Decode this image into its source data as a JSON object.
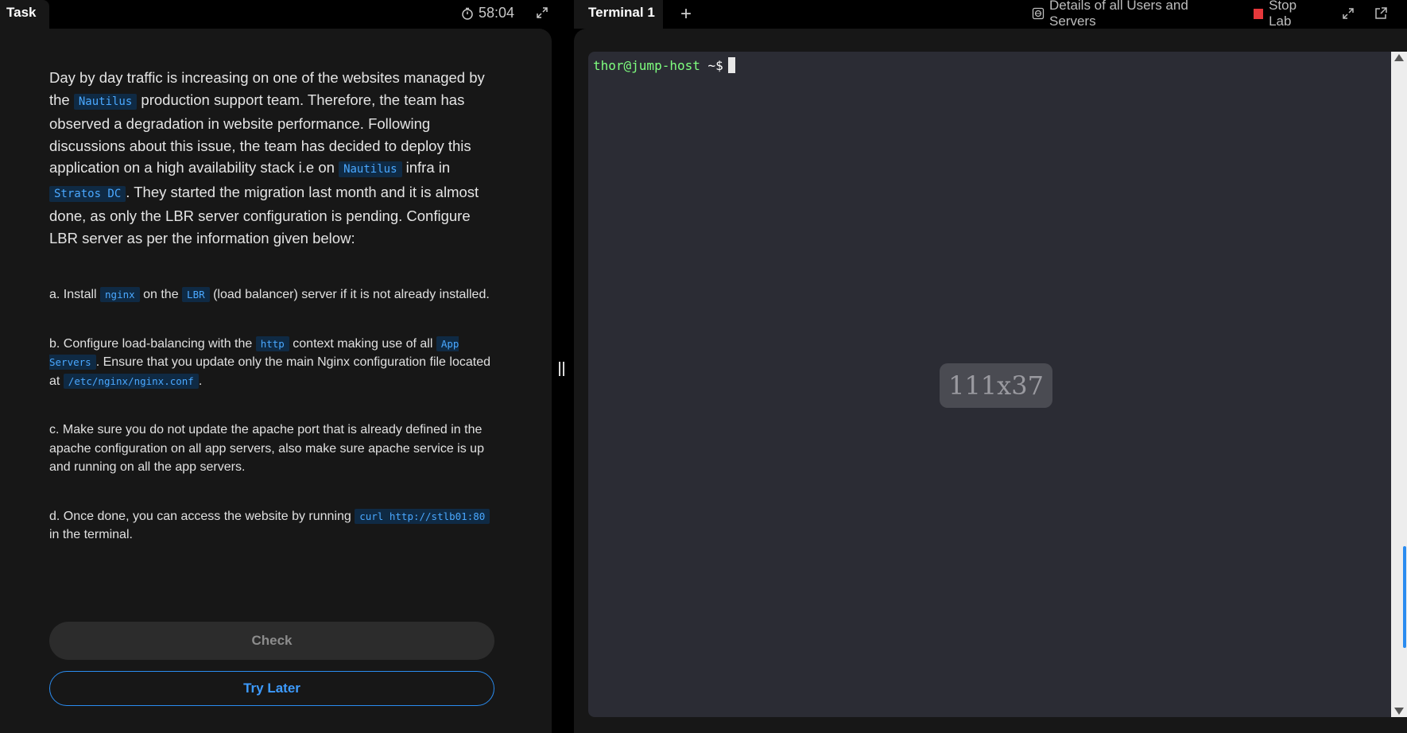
{
  "left": {
    "tab_label": "Task",
    "timer": "58:04"
  },
  "task": {
    "intro": [
      {
        "t": "Day by day traffic is increasing on one of the websites managed by the "
      },
      {
        "c": "Nautilus"
      },
      {
        "t": " production support team. Therefore, the team has observed a degradation in website performance. Following discussions about this issue, the team has decided to deploy this application on a high availability stack i.e on "
      },
      {
        "c": "Nautilus"
      },
      {
        "t": " infra in "
      },
      {
        "c": "Stratos DC"
      },
      {
        "t": ". They started the migration last month and it is almost done, as only the LBR server configuration is pending. Configure LBR server as per the information given below:"
      }
    ],
    "steps": [
      [
        {
          "t": "a. Install "
        },
        {
          "c": "nginx"
        },
        {
          "t": " on the "
        },
        {
          "c": "LBR"
        },
        {
          "t": " (load balancer) server if it is not already installed."
        }
      ],
      [
        {
          "t": "b. Configure load-balancing with the "
        },
        {
          "c": "http"
        },
        {
          "t": " context making use of all "
        },
        {
          "c": "App Servers"
        },
        {
          "t": ". Ensure that you update only the main Nginx configuration file located at "
        },
        {
          "c": "/etc/nginx/nginx.conf"
        },
        {
          "t": "."
        }
      ],
      [
        {
          "t": "c. Make sure you do not update the apache port that is already defined in the apache configuration on all app servers, also make sure apache service is up and running on all the app servers."
        }
      ],
      [
        {
          "t": "d. Once done, you can access the website by running "
        },
        {
          "c": "curl http://stlb01:80"
        },
        {
          "t": " in the terminal."
        }
      ]
    ],
    "check_label": "Check",
    "try_later_label": "Try Later"
  },
  "terminal": {
    "tab_label": "Terminal 1",
    "add_tab_symbol": "+",
    "details_label": "Details of all Users and Servers",
    "stop_lab_label": "Stop Lab",
    "prompt_user_host": "thor@jump-host",
    "prompt_symbol": " ~$",
    "size_overlay": "111x37"
  },
  "colors": {
    "accent_blue": "#2a8cf0",
    "prompt_green": "#7fff7f",
    "stop_red": "#e5383b"
  }
}
